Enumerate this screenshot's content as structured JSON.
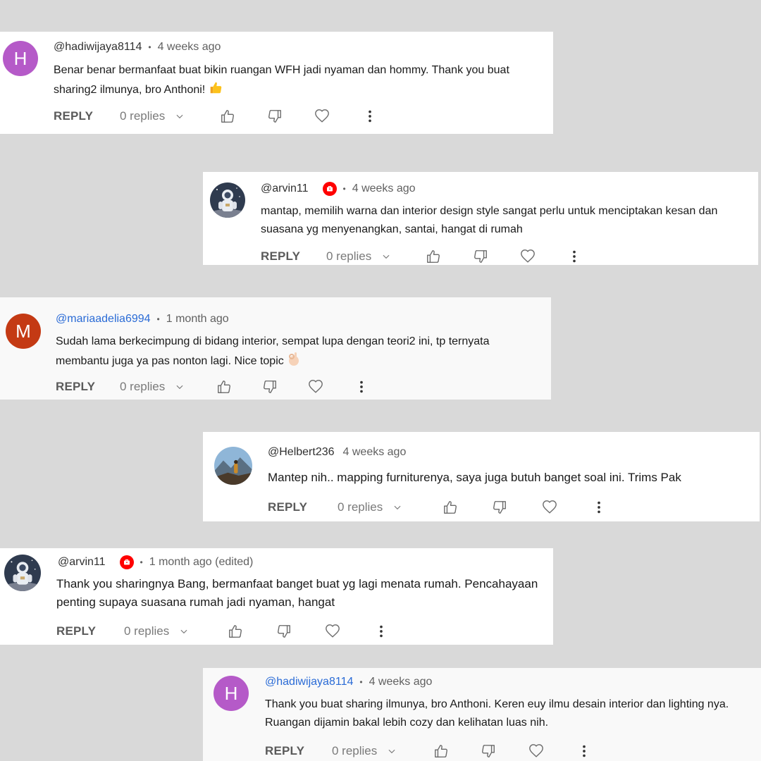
{
  "comments": [
    {
      "handle": "@hadiwijaya8114",
      "time": "4 weeks ago",
      "avatar_letter": "H",
      "avatar_color": "#b55ac8",
      "line1": "Benar benar bermanfaat buat bikin ruangan WFH jadi nyaman dan hommy. Thank you buat",
      "line2": "sharing2 ilmunya, bro Anthoni!",
      "emoji": "thumbs-up",
      "reply": "REPLY",
      "replies": "0 replies"
    },
    {
      "handle": "@arvin11",
      "time": "4 weeks ago",
      "avatar_image": "astronaut",
      "line1": "mantap, memilih warna dan interior design style sangat perlu untuk menciptakan kesan dan",
      "line2": "suasana yg menyenangkan, santai, hangat di rumah",
      "reply": "REPLY",
      "replies": "0 replies"
    },
    {
      "handle": "@mariaadelia6994",
      "time": "1 month ago",
      "avatar_letter": "M",
      "avatar_color": "#c43a14",
      "line1": "Sudah lama berkecimpung di bidang interior, sempat lupa dengan teori2 ini, tp ternyata",
      "line2": "membantu juga ya pas nonton lagi. Nice topic",
      "emoji": "ok-hand",
      "reply": "REPLY",
      "replies": "0 replies"
    },
    {
      "handle": "@Helbert236",
      "time": "4 weeks ago",
      "avatar_image": "mountain",
      "line1": "Mantep nih.. mapping furniturenya, saya juga butuh banget soal ini. Trims Pak",
      "reply": "REPLY",
      "replies": "0 replies"
    },
    {
      "handle": "@arvin11",
      "time": "1 month ago (edited)",
      "avatar_image": "astronaut",
      "line1": "Thank you sharingnya Bang, bermanfaat banget buat yg lagi menata rumah. Pencahayaan",
      "line2": "penting supaya suasana rumah jadi nyaman, hangat",
      "reply": "REPLY",
      "replies": "0 replies"
    },
    {
      "handle": "@hadiwijaya8114",
      "time": "4 weeks ago",
      "avatar_letter": "H",
      "avatar_color": "#b55ac8",
      "line1": "Thank you buat sharing ilmunya, bro Anthoni. Keren euy ilmu desain interior dan lighting nya.",
      "line2": "Ruangan dijamin bakal lebih cozy dan kelihatan luas nih.",
      "reply": "REPLY",
      "replies": "0 replies"
    }
  ],
  "colors": {
    "background": "#d9d9d9",
    "youtube_red": "#ff0000",
    "link_blue": "#2a6bd6"
  }
}
